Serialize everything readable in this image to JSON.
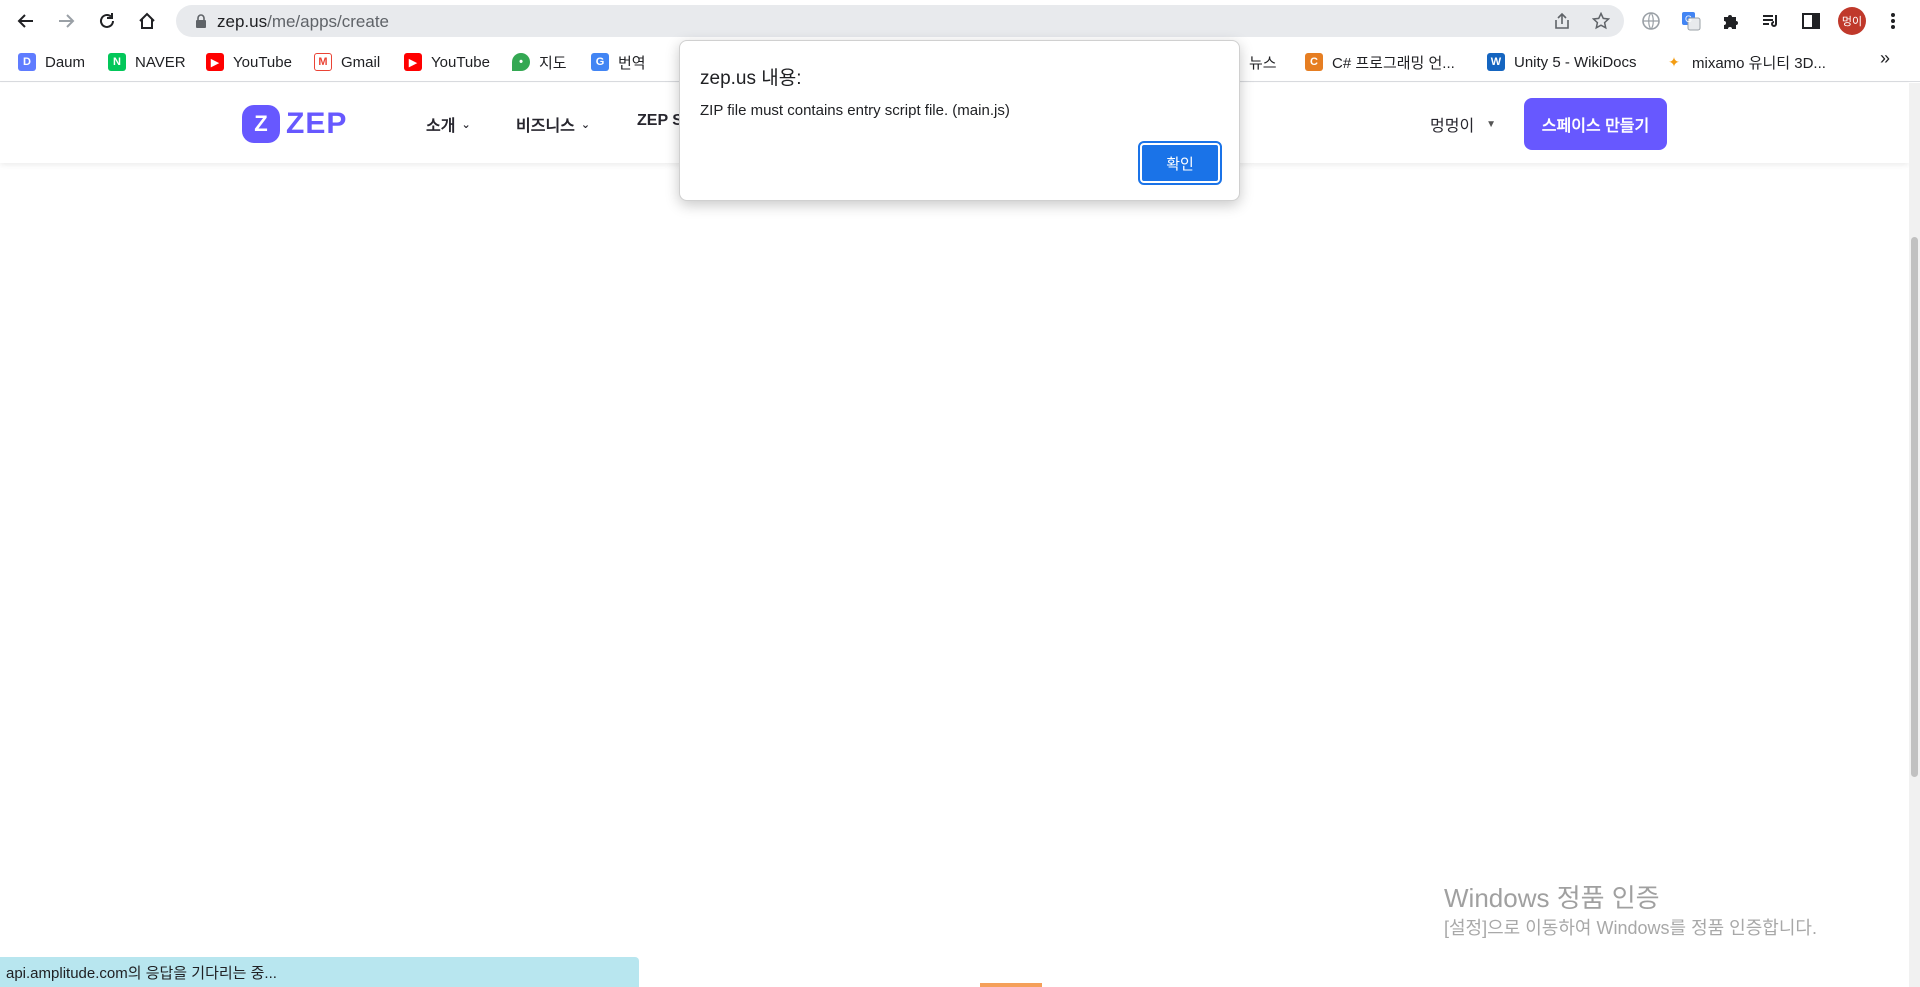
{
  "browser": {
    "url_host": "zep.us",
    "url_path": "/me/apps/create",
    "profile_initials": "멍이"
  },
  "bookmarks": [
    {
      "label": "Daum",
      "icon": "daum-icon",
      "color": "#5f7cff"
    },
    {
      "label": "NAVER",
      "icon": "naver-icon",
      "color": "#03c75a"
    },
    {
      "label": "YouTube",
      "icon": "youtube-icon",
      "color": "#ff0000"
    },
    {
      "label": "Gmail",
      "icon": "gmail-icon",
      "color": "#ea4335"
    },
    {
      "label": "YouTube",
      "icon": "youtube-icon",
      "color": "#ff0000"
    },
    {
      "label": "지도",
      "icon": "maps-icon",
      "color": "#34a853"
    },
    {
      "label": "번역",
      "icon": "translate-icon",
      "color": "#4285f4"
    },
    {
      "label": "뉴스",
      "icon": "news-icon",
      "color": "#7e57c2"
    },
    {
      "label": "C# 프로그래밍 언...",
      "icon": "csharp-icon",
      "color": "#e67e22"
    },
    {
      "label": "Unity 5 - WikiDocs",
      "icon": "wikidocs-icon",
      "color": "#1565c0"
    },
    {
      "label": "mixamo 유니티 3D...",
      "icon": "mixamo-icon",
      "color": "#f39c12"
    }
  ],
  "bookmarks_more": "»",
  "site": {
    "logo_mark": "Z",
    "logo_text": "ZEP",
    "menu": [
      "소개",
      "비즈니스",
      "ZEP S"
    ],
    "user": "멍멍이",
    "cta": "스페이스 만들기",
    "brand_color": "#6758ff"
  },
  "dialog": {
    "title": "zep.us 내용:",
    "message": "ZIP file must contains entry script file. (main.js)",
    "ok": "확인"
  },
  "watermark": {
    "title": "Windows 정품 인증",
    "subtitle": "[설정]으로 이동하여 Windows를 정품 인증합니다."
  },
  "status": "api.amplitude.com의 응답을 기다리는 중..."
}
